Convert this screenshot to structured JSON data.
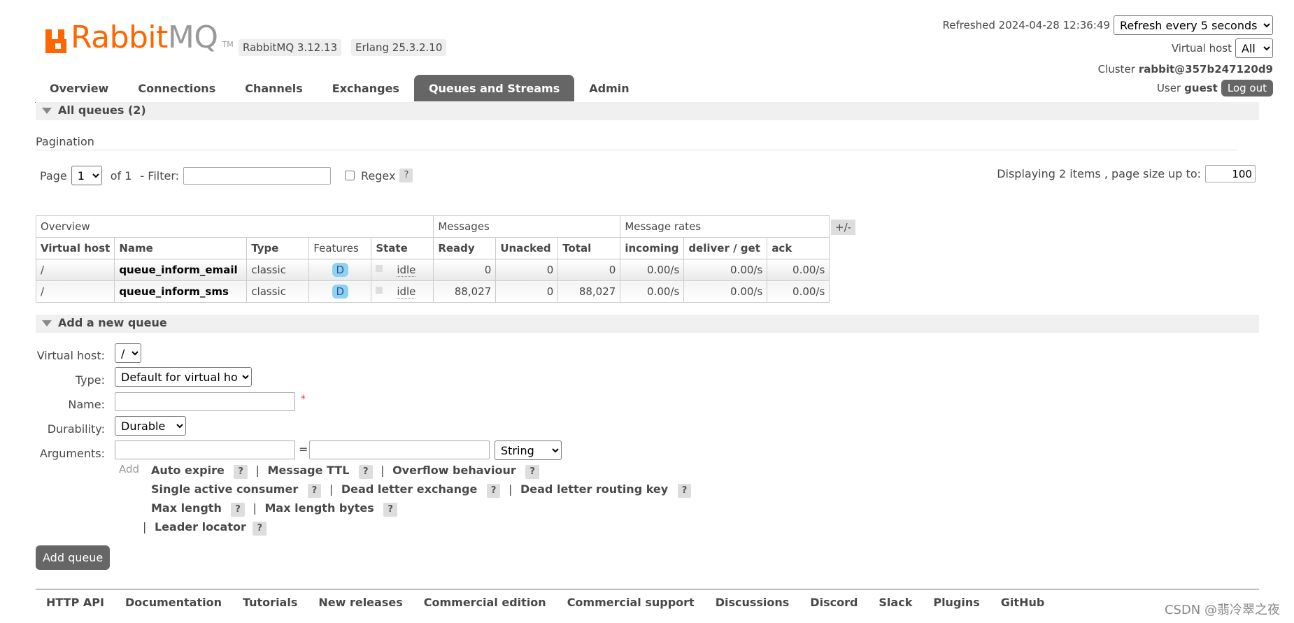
{
  "brand": {
    "rabbit": "Rabbit",
    "mq": "MQ",
    "tm": "TM"
  },
  "versions": {
    "rabbitmq": "RabbitMQ 3.12.13",
    "erlang": "Erlang 25.3.2.10"
  },
  "top": {
    "refreshed": "Refreshed 2024-04-28 12:36:49",
    "refresh_option": "Refresh every 5 seconds",
    "vhost_label": "Virtual host",
    "vhost_option": "All",
    "cluster_label": "Cluster",
    "cluster_name": "rabbit@357b247120d9",
    "user_label": "User",
    "user_name": "guest",
    "logout": "Log out"
  },
  "tabs": [
    {
      "label": "Overview"
    },
    {
      "label": "Connections"
    },
    {
      "label": "Channels"
    },
    {
      "label": "Exchanges"
    },
    {
      "label": "Queues and Streams"
    },
    {
      "label": "Admin"
    }
  ],
  "all_queues": "All queues (2)",
  "pagination": {
    "title": "Pagination",
    "page_label": "Page",
    "page_value": "1",
    "of": "of 1",
    "filter_label": "- Filter:",
    "filter_value": "",
    "regex_label": "Regex",
    "help": "?",
    "displaying": "Displaying 2 items , page size up to:",
    "page_size": "100"
  },
  "table": {
    "groups": [
      "Overview",
      "Messages",
      "Message rates"
    ],
    "plusminus": "+/-",
    "columns": [
      "Virtual host",
      "Name",
      "Type",
      "Features",
      "State",
      "Ready",
      "Unacked",
      "Total",
      "incoming",
      "deliver / get",
      "ack"
    ],
    "rows": [
      {
        "vhost": "/",
        "name": "queue_inform_email",
        "type": "classic",
        "feature": "D",
        "state": "idle",
        "ready": "0",
        "unacked": "0",
        "total": "0",
        "incoming": "0.00/s",
        "deliver": "0.00/s",
        "ack": "0.00/s"
      },
      {
        "vhost": "/",
        "name": "queue_inform_sms",
        "type": "classic",
        "feature": "D",
        "state": "idle",
        "ready": "88,027",
        "unacked": "0",
        "total": "88,027",
        "incoming": "0.00/s",
        "deliver": "0.00/s",
        "ack": "0.00/s"
      }
    ]
  },
  "add_queue": {
    "title": "Add a new queue",
    "vhost_label": "Virtual host:",
    "vhost_value": "/",
    "type_label": "Type:",
    "type_value": "Default for virtual host",
    "name_label": "Name:",
    "name_value": "",
    "required": "*",
    "durability_label": "Durability:",
    "durability_value": "Durable",
    "arguments_label": "Arguments:",
    "equals": "=",
    "arg_type": "String",
    "add": "Add",
    "args": {
      "auto_expire": "Auto expire",
      "message_ttl": "Message TTL",
      "overflow": "Overflow behaviour",
      "single_active": "Single active consumer",
      "dlx": "Dead letter exchange",
      "dlrk": "Dead letter routing key",
      "max_length": "Max length",
      "max_length_bytes": "Max length bytes",
      "leader_locator": "Leader locator"
    },
    "sep": "|",
    "button": "Add queue"
  },
  "footer": [
    "HTTP API",
    "Documentation",
    "Tutorials",
    "New releases",
    "Commercial edition",
    "Commercial support",
    "Discussions",
    "Discord",
    "Slack",
    "Plugins",
    "GitHub"
  ],
  "watermark": "CSDN @翡冷翠之夜"
}
